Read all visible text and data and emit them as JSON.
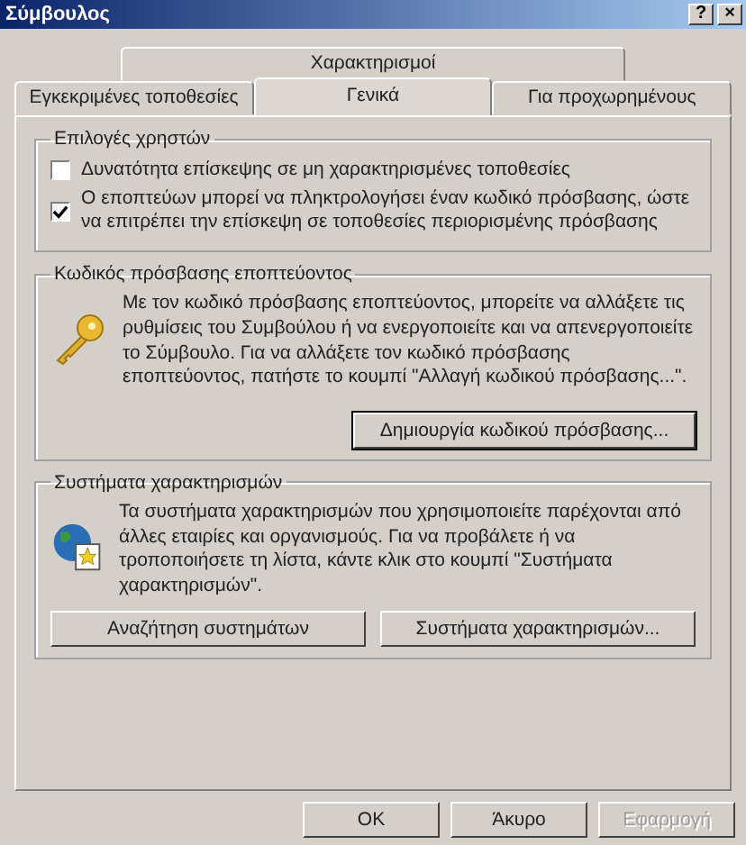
{
  "window": {
    "title": "Σύμβουλος",
    "help": "?",
    "close": "×"
  },
  "tab_rows": [
    [
      {
        "label": "Χαρακτηρισμοί",
        "selected": false
      }
    ],
    [
      {
        "label": "Εγκεκριμένες τοποθεσίες",
        "selected": false
      },
      {
        "label": "Γενικά",
        "selected": true
      },
      {
        "label": "Για προχωρημένους",
        "selected": false
      }
    ]
  ],
  "user_options": {
    "title": "Επιλογές χρηστών",
    "options": [
      {
        "label": "Δυνατότητα επίσκεψης σε μη χαρακτηρισμένες τοποθεσίες",
        "checked": false
      },
      {
        "label": "Ο εποπτεύων μπορεί να πληκτρολογήσει έναν κωδικό πρόσβασης, ώστε να επιτρέπει την επίσκεψη σε τοποθεσίες περιορισμένης πρόσβασης",
        "checked": true
      }
    ]
  },
  "supervisor_password": {
    "title": "Κωδικός πρόσβασης εποπτεύοντος",
    "text": "Με τον κωδικό πρόσβασης εποπτεύοντος, μπορείτε να αλλάξετε τις ρυθμίσεις του Συμβούλου ή να ενεργοποιείτε και να απενεργοποιείτε το Σύμβουλο. Για να αλλάξετε τον κωδικό πρόσβασης εποπτεύοντος, πατήστε το κουμπί \"Αλλαγή κωδικού πρόσβασης...\".",
    "button": "Δημιουργία κωδικού πρόσβασης..."
  },
  "rating_systems": {
    "title": "Συστήματα χαρακτηρισμών",
    "text": "Τα συστήματα χαρακτηρισμών που χρησιμοποιείτε παρέχονται από άλλες εταιρίες και οργανισμούς. Για να προβάλετε ή να τροποποιήσετε τη λίστα, κάντε κλικ στο κουμπί \"Συστήματα χαρακτηρισμών\".",
    "buttons": [
      "Αναζήτηση συστημάτων",
      "Συστήματα χαρακτηρισμών..."
    ]
  },
  "buttons": [
    {
      "label": "OK",
      "disabled": false
    },
    {
      "label": "Άκυρο",
      "disabled": false
    },
    {
      "label": "Εφαρμογή",
      "disabled": true
    }
  ]
}
